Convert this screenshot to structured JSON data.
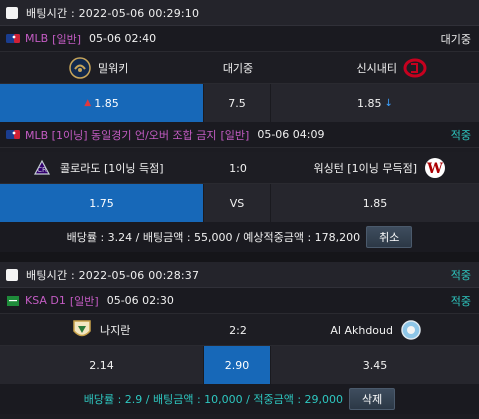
{
  "bets": [
    {
      "bet_time": "배팅시간 : 2022-05-06 00:29:10",
      "status": "",
      "games": [
        {
          "league": "MLB",
          "tag": "[일반]",
          "time": "05-06 02:40",
          "state": "대기중",
          "home": "밀워키",
          "mid": "대기중",
          "away": "신시내티",
          "odds": {
            "home": "1.85",
            "mid": "7.5",
            "away": "1.85"
          }
        }
      ]
    },
    {
      "games": [
        {
          "league": "MLB [1이닝] 동일경기 언/오버 조합 금지",
          "tag": "[일반]",
          "time": "05-06 04:09",
          "state": "적중",
          "home": "콜로라도 [1이닝 득점]",
          "mid": "1:0",
          "away": "워싱턴 [1이닝 무득점]",
          "odds": {
            "home": "1.75",
            "mid": "VS",
            "away": "1.85"
          }
        }
      ],
      "summary": "배당률 : 3.24 / 배팅금액 : 55,000 / 예상적중금액 : 178,200",
      "button": "취소"
    },
    {
      "bet_time": "배팅시간 : 2022-05-06 00:28:37",
      "status": "적중",
      "games": [
        {
          "league": "KSA D1",
          "tag": "[일반]",
          "time": "05-06 02:30",
          "state": "적중",
          "home": "나지란",
          "mid": "2:2",
          "away": "Al Akhdoud",
          "odds": {
            "home": "2.14",
            "mid": "2.90",
            "away": "3.45"
          }
        }
      ],
      "summary": "배당률 : 2.9 / 배팅금액 : 10,000 / 적중금액 : 29,000",
      "button": "삭제"
    }
  ],
  "colors": {
    "selected": "#1768b8",
    "teal": "#2ec7c0",
    "league": "#c45cc4",
    "up": "#e0383e",
    "down": "#3aa0ff"
  },
  "icons": {
    "mlb": "mlb-logo-icon",
    "ksa": "ksa-flag-icon",
    "milwaukee": "brewers-logo-icon",
    "cincinnati": "reds-logo-icon",
    "colorado": "rockies-logo-icon",
    "washington": "nationals-logo-icon",
    "najran": "najran-logo-icon",
    "akhdoud": "akhdoud-logo-icon"
  }
}
